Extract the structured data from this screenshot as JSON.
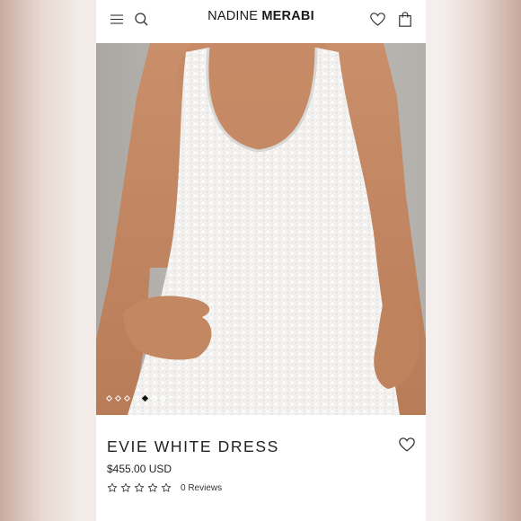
{
  "brand": {
    "name_light": "NADINE",
    "name_bold": "MERABI"
  },
  "header_icons": [
    "menu-icon",
    "search-icon",
    "heart-icon",
    "bag-icon"
  ],
  "gallery": {
    "slide_count": 7,
    "active_index": 4
  },
  "product": {
    "title": "EVIE WHITE DRESS",
    "price": "$455.00 USD",
    "rating": 0,
    "reviews_label": "0 Reviews"
  },
  "colors": {
    "text": "#222222",
    "background": "#ffffff",
    "dress": "#f4f3f1"
  }
}
